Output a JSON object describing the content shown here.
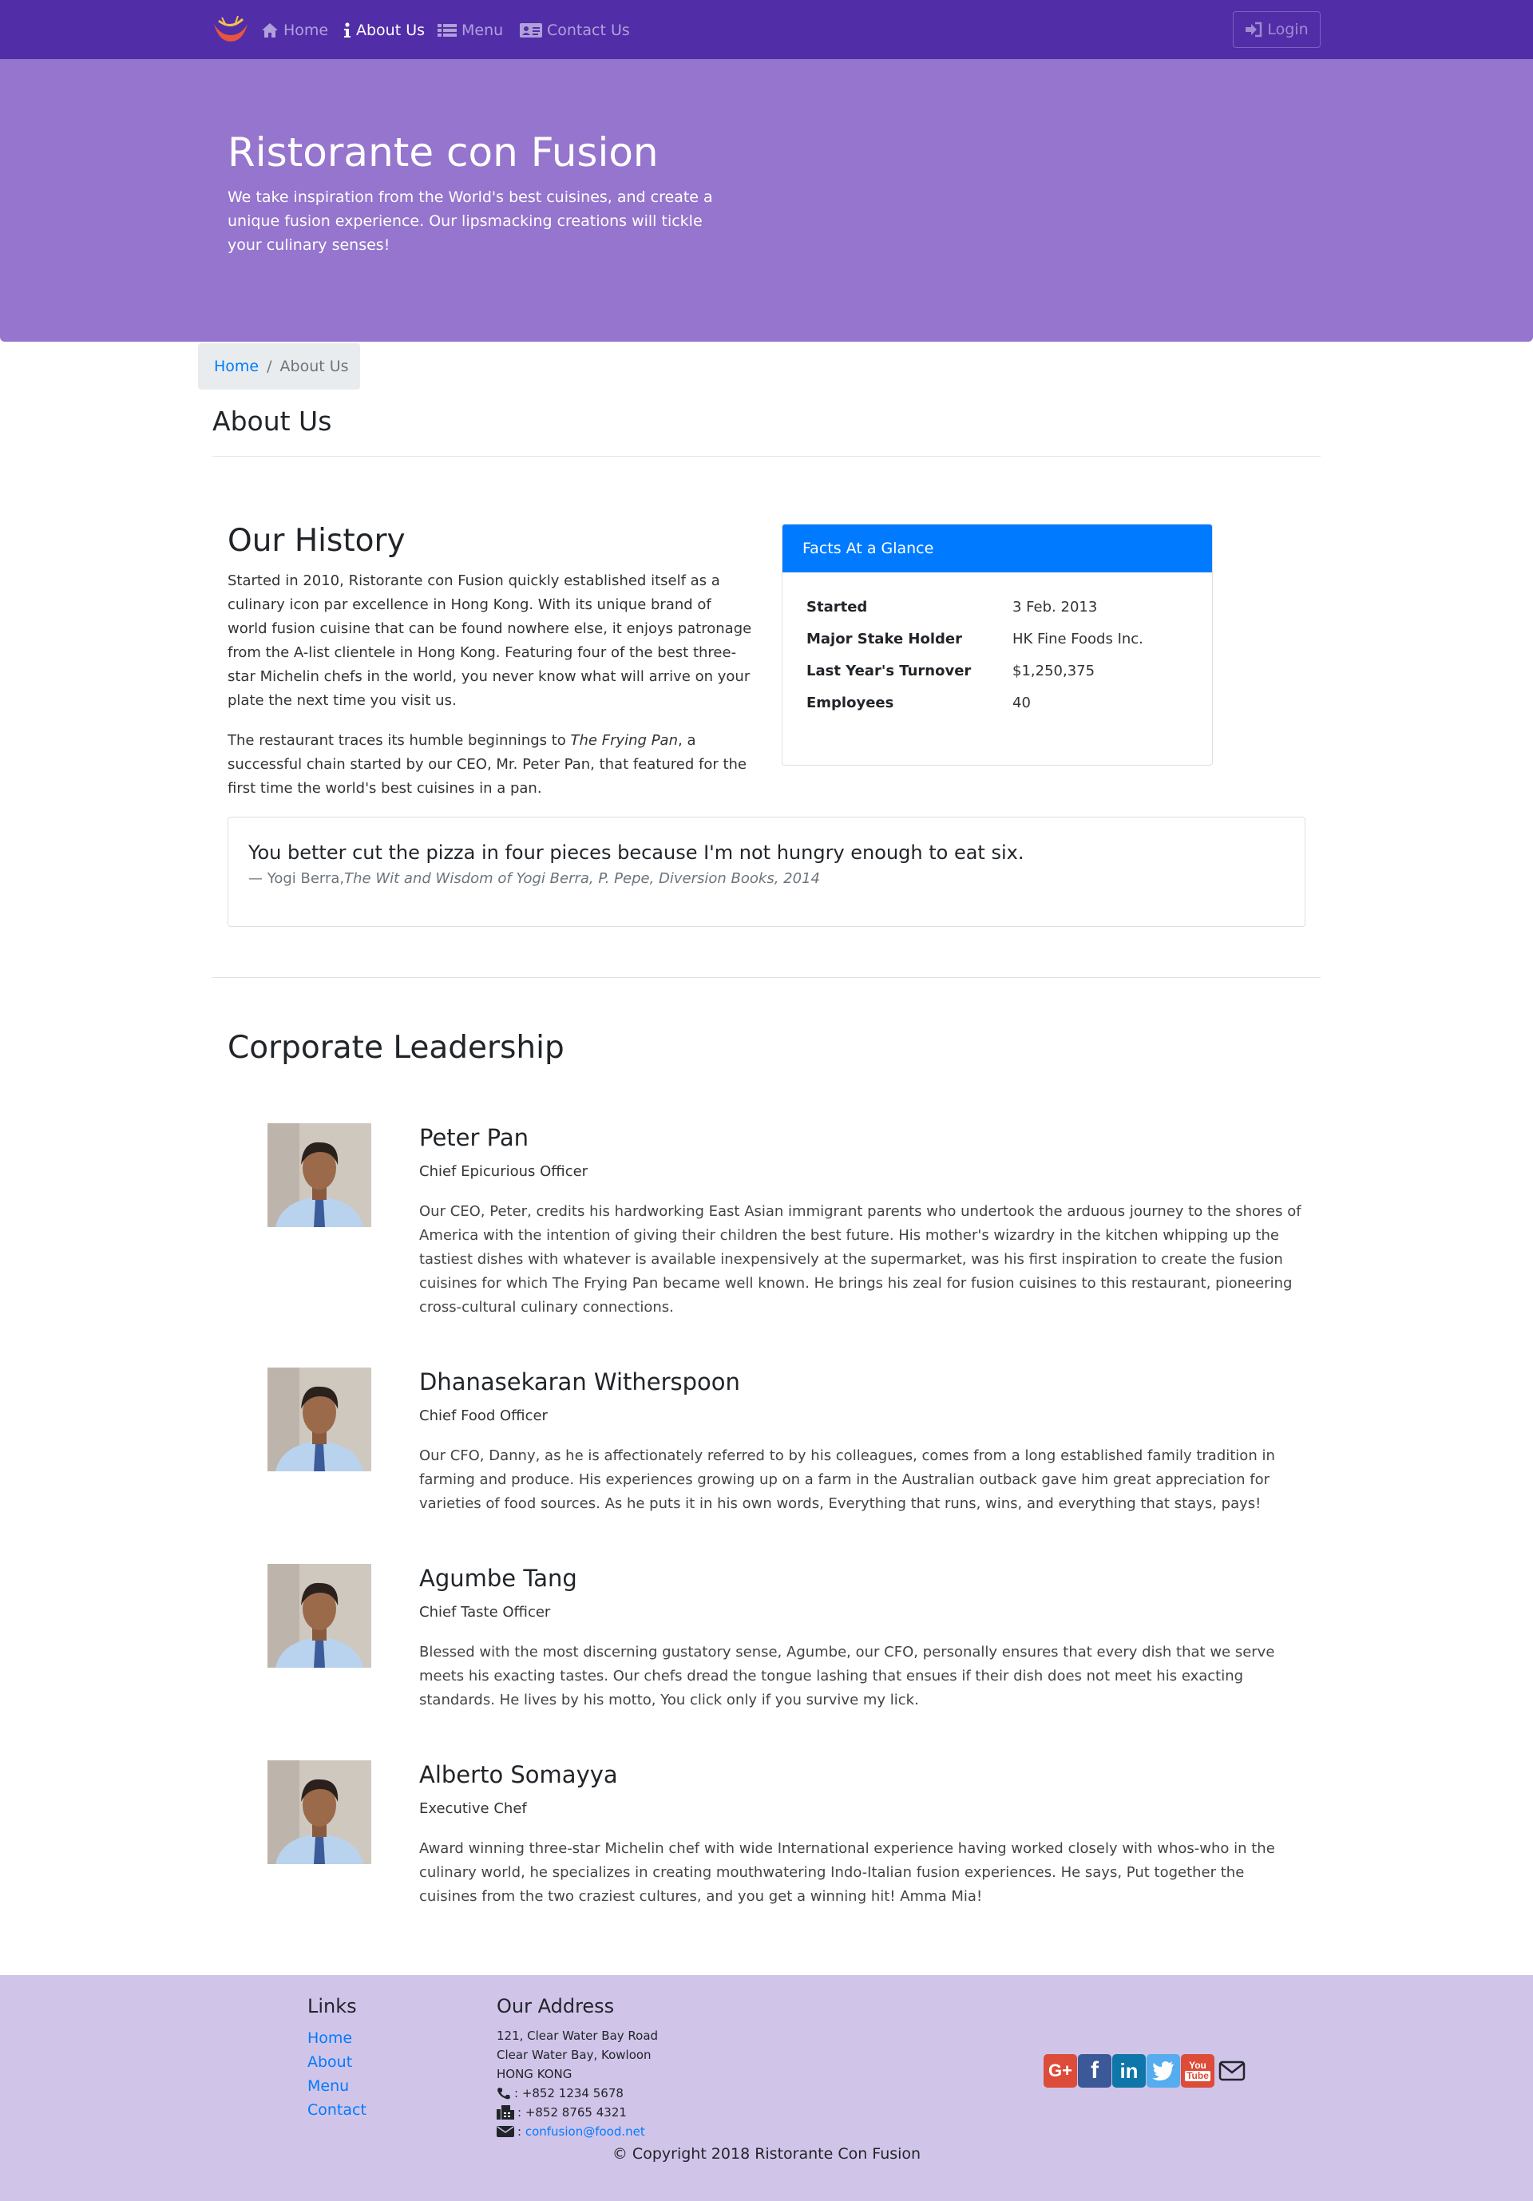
{
  "nav": {
    "items": [
      {
        "label": "Home",
        "icon": "home-icon"
      },
      {
        "label": "About Us",
        "icon": "info-icon"
      },
      {
        "label": "Menu",
        "icon": "list-icon"
      },
      {
        "label": "Contact Us",
        "icon": "address-card-icon"
      }
    ],
    "active": "About Us",
    "login_label": "Login"
  },
  "jumbotron": {
    "title": "Ristorante con Fusion",
    "text": "We take inspiration from the World's best cuisines, and create a unique fusion experience. Our lipsmacking creations will tickle your culinary senses!"
  },
  "breadcrumb": {
    "home": "Home",
    "separator": "/",
    "current": "About Us"
  },
  "page_title": "About Us",
  "history": {
    "title": "Our History",
    "p1": "Started in 2010, Ristorante con Fusion quickly established itself as a culinary icon par excellence in Hong Kong. With its unique brand of world fusion cuisine that can be found nowhere else, it enjoys patronage from the A-list clientele in Hong Kong. Featuring four of the best three-star Michelin chefs in the world, you never know what will arrive on your plate the next time you visit us.",
    "p2_before": "The restaurant traces its humble beginnings to ",
    "p2_em": "The Frying Pan",
    "p2_after": ", a successful chain started by our CEO, Mr. Peter Pan, that featured for the first time the world's best cuisines in a pan."
  },
  "facts": {
    "header": "Facts At a Glance",
    "rows": [
      {
        "label": "Started",
        "value": "3 Feb. 2013"
      },
      {
        "label": "Major Stake Holder",
        "value": "HK Fine Foods Inc."
      },
      {
        "label": "Last Year's Turnover",
        "value": "$1,250,375"
      },
      {
        "label": "Employees",
        "value": "40"
      }
    ]
  },
  "quote": {
    "text": "You better cut the pizza in four pieces because I'm not hungry enough to eat six.",
    "author": "— Yogi Berra,",
    "source": "The Wit and Wisdom of Yogi Berra, P. Pepe, Diversion Books, 2014"
  },
  "leadership": {
    "title": "Corporate Leadership",
    "leaders": [
      {
        "name": "Peter Pan",
        "role": "Chief Epicurious Officer",
        "description": "Our CEO, Peter, credits his hardworking East Asian immigrant parents who undertook the arduous journey to the shores of America with the intention of giving their children the best future. His mother's wizardry in the kitchen whipping up the tastiest dishes with whatever is available inexpensively at the supermarket, was his first inspiration to create the fusion cuisines for which The Frying Pan became well known. He brings his zeal for fusion cuisines to this restaurant, pioneering cross-cultural culinary connections."
      },
      {
        "name": "Dhanasekaran Witherspoon",
        "role": "Chief Food Officer",
        "description": "Our CFO, Danny, as he is affectionately referred to by his colleagues, comes from a long established family tradition in farming and produce. His experiences growing up on a farm in the Australian outback gave him great appreciation for varieties of food sources. As he puts it in his own words, Everything that runs, wins, and everything that stays, pays!"
      },
      {
        "name": "Agumbe Tang",
        "role": "Chief Taste Officer",
        "description": "Blessed with the most discerning gustatory sense, Agumbe, our CFO, personally ensures that every dish that we serve meets his exacting tastes. Our chefs dread the tongue lashing that ensues if their dish does not meet his exacting standards. He lives by his motto, You click only if you survive my lick."
      },
      {
        "name": "Alberto Somayya",
        "role": "Executive Chef",
        "description": "Award winning three-star Michelin chef with wide International experience having worked closely with whos-who in the culinary world, he specializes in creating mouthwatering Indo-Italian fusion experiences. He says, Put together the cuisines from the two craziest cultures, and you get a winning hit! Amma Mia!"
      }
    ]
  },
  "footer": {
    "links_heading": "Links",
    "links": [
      "Home",
      "About",
      "Menu",
      "Contact"
    ],
    "address_heading": "Our Address",
    "address": [
      "121, Clear Water Bay Road",
      "Clear Water Bay, Kowloon",
      "HONG KONG"
    ],
    "phone": ": +852 1234 5678",
    "fax": ": +852 8765 4321",
    "email": "confusion@food.net",
    "socials": [
      "google-plus-icon",
      "facebook-icon",
      "linkedin-icon",
      "twitter-icon",
      "youtube-icon",
      "envelope-icon"
    ],
    "copyright": "© Copyright 2018 Ristorante Con Fusion"
  },
  "colors": {
    "nav": "#512da8",
    "jumbotron": "#9575cd",
    "footer": "#d1c4e9",
    "primary": "#007bff"
  }
}
